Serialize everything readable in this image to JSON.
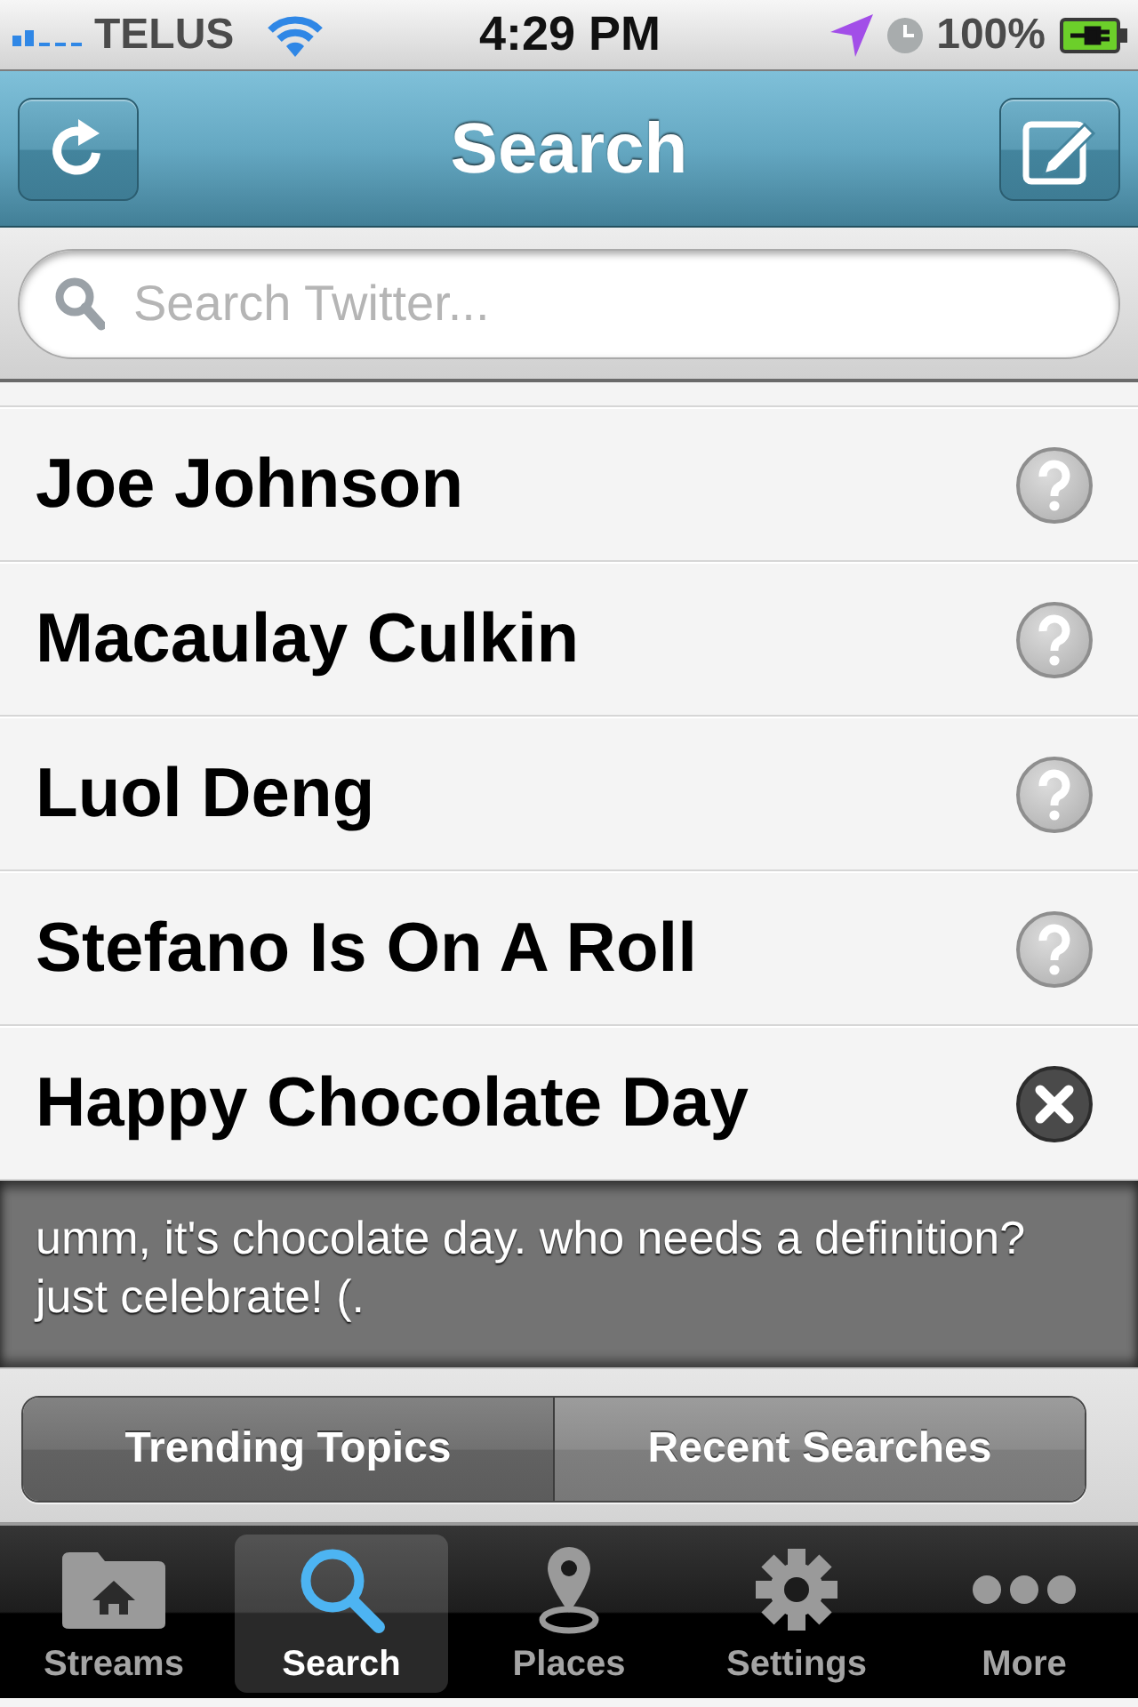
{
  "status_bar": {
    "carrier": "TELUS",
    "time": "4:29 PM",
    "battery": "100%"
  },
  "nav_bar": {
    "title": "Search"
  },
  "search": {
    "placeholder": "Search Twitter..."
  },
  "topics": [
    {
      "name": "Joe Johnson",
      "expanded": false
    },
    {
      "name": "Macaulay Culkin",
      "expanded": false
    },
    {
      "name": "Luol Deng",
      "expanded": false
    },
    {
      "name": "Stefano Is On A Roll",
      "expanded": false
    },
    {
      "name": "Happy Chocolate Day",
      "expanded": true,
      "definition": "umm, it's chocolate day. who needs a definition? just celebrate! (."
    }
  ],
  "segments": [
    {
      "label": "Trending Topics",
      "selected": true
    },
    {
      "label": "Recent Searches",
      "selected": false
    }
  ],
  "tab_bar": {
    "tabs": [
      {
        "label": "Streams",
        "selected": false
      },
      {
        "label": "Search",
        "selected": true
      },
      {
        "label": "Places",
        "selected": false
      },
      {
        "label": "Settings",
        "selected": false
      },
      {
        "label": "More",
        "selected": false
      }
    ]
  }
}
